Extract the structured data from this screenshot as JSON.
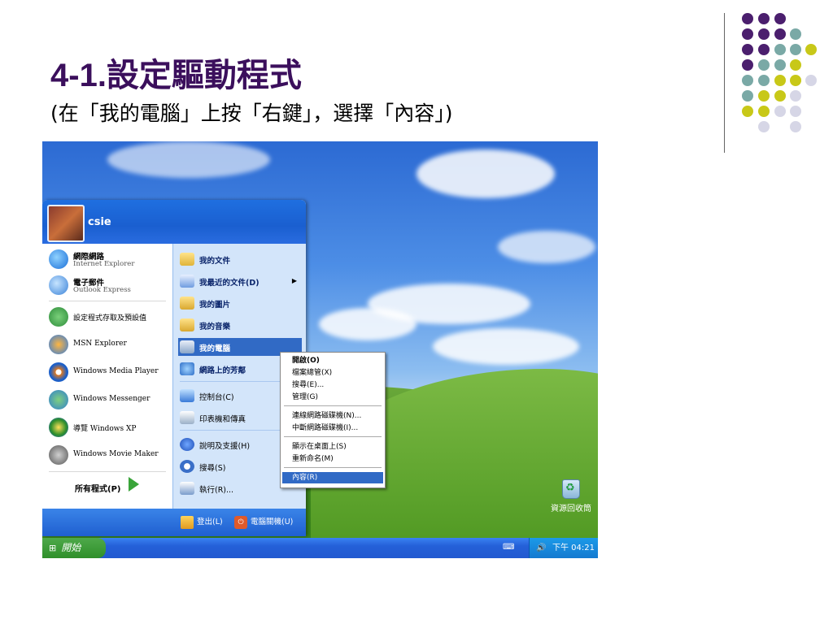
{
  "slide": {
    "title": "4-1.設定驅動程式",
    "subtitle": "(在「我的電腦」上按「右鍵」，選擇「內容」)"
  },
  "colors": {
    "title": "#3b0f5c",
    "dot_purple": "#4b1f6e",
    "dot_teal": "#7aa9a6",
    "dot_lime": "#c8c818",
    "dot_lavender": "#d6d6e6",
    "xp_blue": "#245edb",
    "highlight": "#316ac5"
  },
  "start_menu": {
    "user": "csie",
    "pinned": [
      {
        "title": "網際網路",
        "sub": "Internet Explorer",
        "icon": "internet-explorer-icon"
      },
      {
        "title": "電子郵件",
        "sub": "Outlook Express",
        "icon": "outlook-express-icon"
      }
    ],
    "recent": [
      {
        "label": "設定程式存取及預設值",
        "icon": "program-defaults-icon"
      },
      {
        "label": "MSN Explorer",
        "icon": "msn-butterfly-icon"
      },
      {
        "label": "Windows Media Player",
        "icon": "media-player-icon"
      },
      {
        "label": "Windows Messenger",
        "icon": "messenger-icon"
      },
      {
        "label": "導覽 Windows XP",
        "icon": "tour-xp-icon"
      },
      {
        "label": "Windows Movie Maker",
        "icon": "movie-maker-icon"
      }
    ],
    "all_programs": "所有程式(P)",
    "places": [
      {
        "label": "我的文件",
        "icon": "folder-icon"
      },
      {
        "label": "我最近的文件(D)",
        "icon": "recent-docs-icon"
      },
      {
        "label": "我的圖片",
        "icon": "pictures-folder-icon"
      },
      {
        "label": "我的音樂",
        "icon": "music-folder-icon"
      },
      {
        "label": "我的電腦",
        "icon": "computer-icon"
      },
      {
        "label": "網路上的芳鄰",
        "icon": "network-icon"
      }
    ],
    "system": [
      {
        "label": "控制台(C)",
        "icon": "control-panel-icon"
      },
      {
        "label": "印表機和傳真",
        "icon": "printer-icon"
      }
    ],
    "help": [
      {
        "label": "說明及支援(H)",
        "icon": "help-icon"
      },
      {
        "label": "搜尋(S)",
        "icon": "search-icon"
      },
      {
        "label": "執行(R)...",
        "icon": "run-icon"
      }
    ],
    "logoff": "登出(L)",
    "shutdown": "電腦關機(U)"
  },
  "context_menu": {
    "items": [
      {
        "label": "開啟(O)",
        "bold": true
      },
      {
        "label": "檔案總管(X)"
      },
      {
        "label": "搜尋(E)..."
      },
      {
        "label": "管理(G)"
      },
      {
        "label": "連線網路磁碟機(N)..."
      },
      {
        "label": "中斷網路磁碟機(I)..."
      },
      {
        "label": "顯示在桌面上(S)"
      },
      {
        "label": "重新命名(M)"
      },
      {
        "label": "內容(R)",
        "highlighted": true
      }
    ]
  },
  "desktop": {
    "recycle_bin": "資源回收筒"
  },
  "taskbar": {
    "start": "開始",
    "clock": "下午 04:21"
  }
}
